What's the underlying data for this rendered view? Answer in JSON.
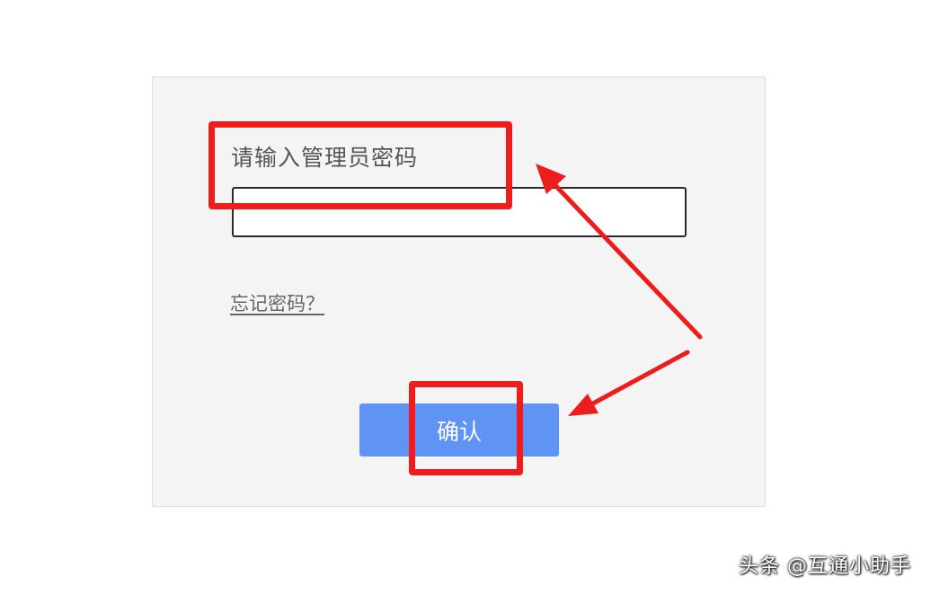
{
  "dialog": {
    "prompt_label": "请输入管理员密码",
    "password_value": "",
    "forgot_link": "忘记密码？",
    "confirm_label": "确认"
  },
  "watermark": "头条 @互通小助手",
  "colors": {
    "dialog_background": "#f4f4f4",
    "button_background": "#5f93f4",
    "annotation_red": "#ee1c1c"
  },
  "icons": [
    "arrow-up-left-icon",
    "arrow-left-icon"
  ]
}
